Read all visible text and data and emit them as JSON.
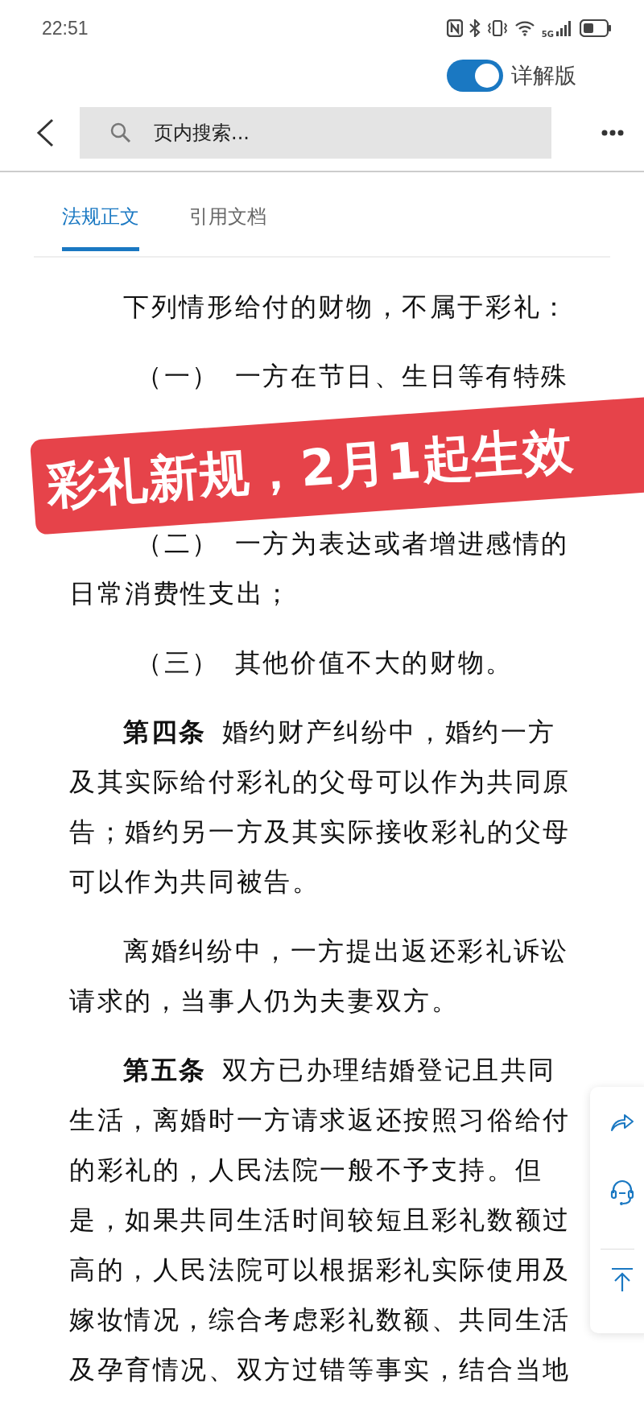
{
  "status_bar": {
    "time": "22:51",
    "network": "5G"
  },
  "toggle": {
    "label": "详解版",
    "on": true
  },
  "search": {
    "placeholder": "页内搜索..."
  },
  "tabs": [
    {
      "label": "法规正文",
      "selected": true
    },
    {
      "label": "引用文档",
      "selected": false
    }
  ],
  "paragraphs": [
    {
      "kind": "text",
      "lines": [
        "下列情形给付的财物，不属于彩礼："
      ]
    },
    {
      "kind": "item",
      "lines": [
        "（一） 一方在节日、生日等有特殊"
      ]
    },
    {
      "kind": "banner",
      "lines": [
        "彩礼新规，2月1起生效"
      ]
    },
    {
      "kind": "item",
      "lines": [
        "（二） 一方为表达或者增进感情的",
        "日常消费性支出；"
      ]
    },
    {
      "kind": "item",
      "lines": [
        "（三） 其他价值不大的财物。"
      ]
    },
    {
      "kind": "text",
      "lines": [
        "**第四条** 婚约财产纠纷中，婚约一方",
        "及其实际给付彩礼的父母可以作为共同原",
        "告；婚约另一方及其实际接收彩礼的父母",
        "可以作为共同被告。"
      ]
    },
    {
      "kind": "text",
      "lines": [
        "离婚纠纷中，一方提出返还彩礼诉讼",
        "请求的，当事人仍为夫妻双方。"
      ]
    },
    {
      "kind": "text",
      "lines": [
        "**第五条** 双方已办理结婚登记且共同",
        "生活，离婚时一方请求返还按照习俗给付",
        "的彩礼的，人民法院一般不予支持。但",
        "是，如果共同生活时间较短且彩礼数额过",
        "高的，人民法院可以根据彩礼实际使用及",
        "嫁妆情况，综合考虑彩礼数额、共同生活",
        "及孕育情况、双方过错等事实，结合当地"
      ]
    }
  ]
}
